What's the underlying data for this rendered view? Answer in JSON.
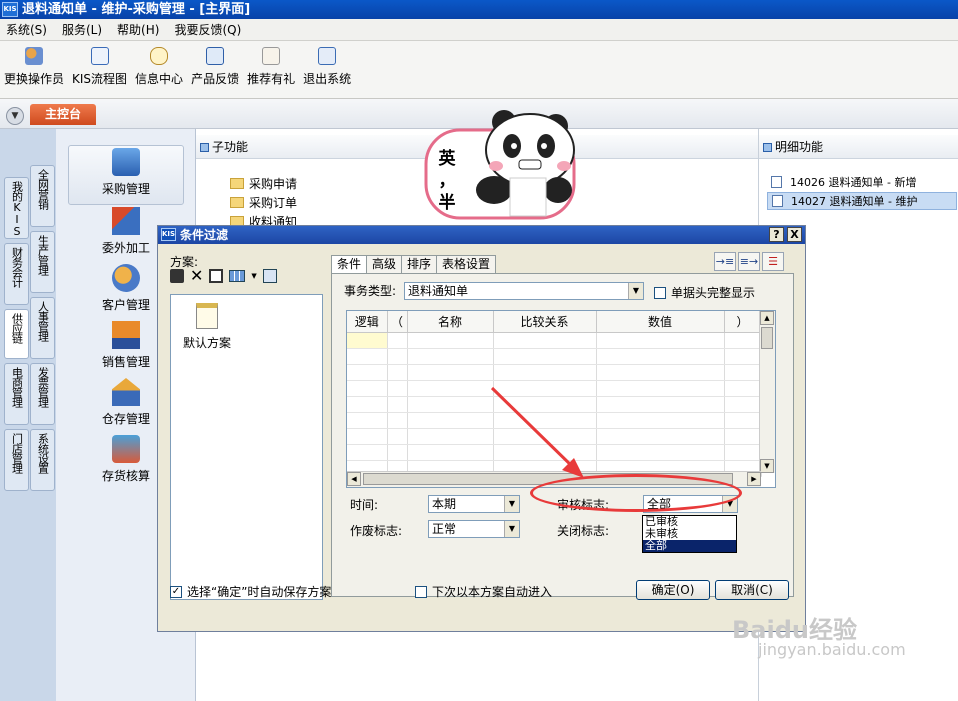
{
  "window": {
    "title": "退料通知单 - 维护-采购管理 - [主界面]",
    "app_badge": "KIS"
  },
  "menu": [
    "系统(S)",
    "服务(L)",
    "帮助(H)",
    "我要反馈(Q)"
  ],
  "toolbar": [
    "更换操作员",
    "KIS流程图",
    "信息中心",
    "产品反馈",
    "推荐有礼",
    "退出系统"
  ],
  "main_tab": "主控台",
  "side_tabs": [
    "我的KIS",
    "全网营销",
    "财务会计",
    "生产管理",
    "供应链",
    "人事管理",
    "电商管理",
    "发票管理",
    "门店管理",
    "系统设置"
  ],
  "modules": [
    "采购管理",
    "委外加工",
    "客户管理",
    "销售管理",
    "仓存管理",
    "存货核算"
  ],
  "sub_panel": {
    "title": "子功能",
    "items": [
      "采购申请",
      "采购订单",
      "收料通知"
    ]
  },
  "detail_panel": {
    "title": "明细功能",
    "items": [
      "14026  退料通知单 - 新增",
      "14027  退料通知单 - 维护"
    ]
  },
  "sticker": {
    "chars": [
      "英",
      "，",
      "半"
    ]
  },
  "dialog": {
    "title": "条件过滤",
    "badge": "KIS",
    "help_btn": "?",
    "close_btn": "X",
    "scheme_label": "方案:",
    "scheme_item": "默认方案",
    "tabs": [
      "条件",
      "高级",
      "排序",
      "表格设置"
    ],
    "business_type_label": "事务类型:",
    "business_type_value": "退料通知单",
    "show_full_header": "单据头完整显示",
    "grid_headers": [
      "逻辑",
      "（",
      "名称",
      "比较关系",
      "数值",
      "）"
    ],
    "time_label": "时间:",
    "time_value": "本期",
    "void_label": "作废标志:",
    "void_value": "正常",
    "audit_label": "审核标志:",
    "audit_value": "全部",
    "close_label": "关闭标志:",
    "audit_options": [
      "已审核",
      "未审核",
      "全部"
    ],
    "save_scheme_check": "选择“确定”时自动保存方案",
    "auto_enter_check": "下次以本方案自动进入",
    "ok": "确定(O)",
    "cancel": "取消(C)"
  },
  "watermark": {
    "line1": "Baidu经验",
    "line2": "jingyan.baidu.com"
  },
  "colors": {
    "title_bar": "#0a58c8",
    "main_tab": "#e0622f",
    "annotation": "#e83a3a"
  }
}
